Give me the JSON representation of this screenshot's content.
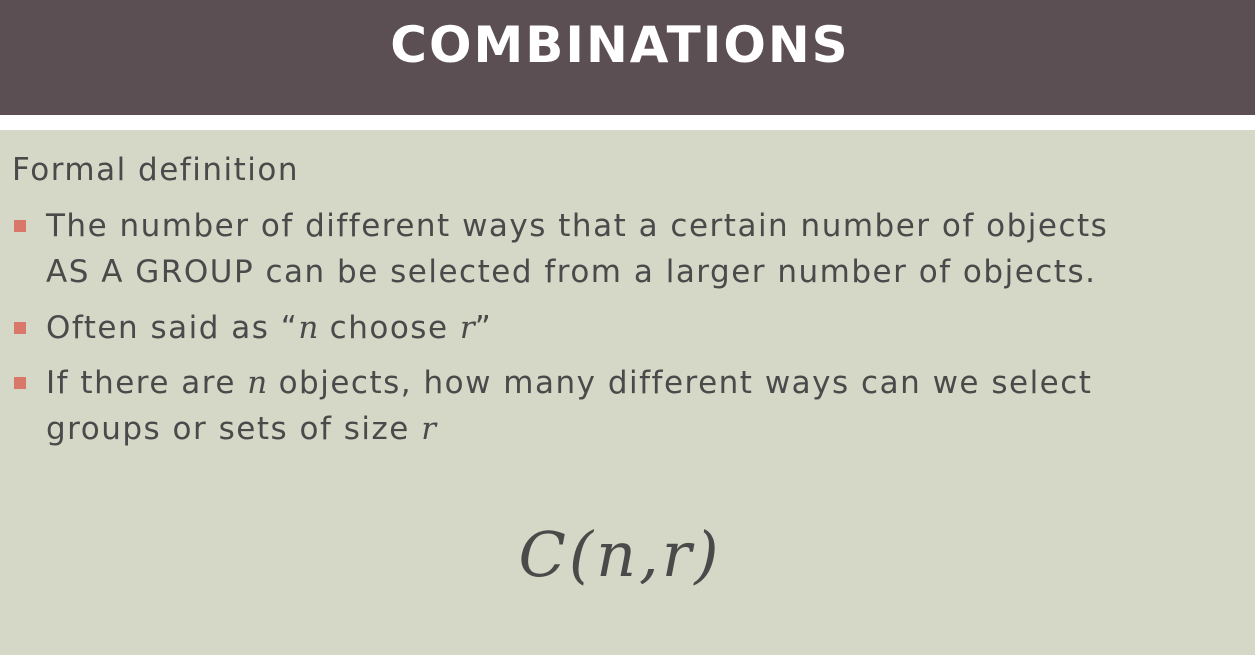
{
  "slide": {
    "title": "COMBINATIONS",
    "heading": "Formal definition",
    "bullets": [
      {
        "line1": "The number of different ways that a certain number of objects",
        "line2": "AS A GROUP can be selected from a larger number of objects."
      },
      {
        "prefix": "Often said as “",
        "var1": "n",
        "middle": " choose ",
        "var2": "r",
        "suffix": "”"
      },
      {
        "prefix": "If there are ",
        "var1": "n",
        "suffix": " objects, how many different ways can we select",
        "line2_text": "groups or sets of size ",
        "var2": "r"
      }
    ],
    "formula": "C(n,r)"
  },
  "colors": {
    "title_bar": "#5b4f53",
    "background": "#d5d8c7",
    "text": "#4a4a4a",
    "bullet_marker": "#d9776a"
  }
}
